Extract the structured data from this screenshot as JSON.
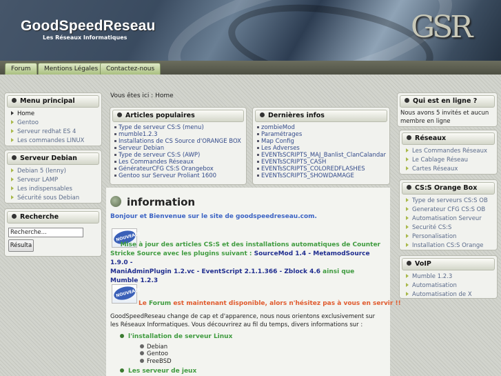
{
  "header": {
    "title": "GoodSpeedReseau",
    "tagline": "Les Réseaux Informatiques",
    "logo": "GSR"
  },
  "nav": {
    "tabs": [
      "Forum",
      "Mentions Légales",
      "Contactez-nous"
    ]
  },
  "breadcrumb": "Vous êtes ici : Home",
  "menu_principal": {
    "title": "Menu principal",
    "items": [
      "Home",
      "Gentoo",
      "Serveur redhat ES 4",
      "Les commandes LINUX"
    ]
  },
  "serveur_debian": {
    "title": "Serveur Debian",
    "items": [
      "Debian 5 (lenny)",
      "Serveur LAMP",
      "Les indispensables",
      "Sécurité sous Debian"
    ]
  },
  "recherche": {
    "title": "Recherche",
    "input_value": "Recherche...",
    "button": "Résulta"
  },
  "articles_populaires": {
    "title": "Articles populaires",
    "items": [
      "Type de serveur CS:S (menu)",
      "mumble1.2.3",
      "Installations de CS Source d'ORANGE BOX",
      "Serveur Debian",
      "Type de serveur CS:S (AWP)",
      "Les Commandes Réseaux",
      "GénérateurCFG CS:S Orangebox",
      "Gentoo sur Serveur Proliant 1600"
    ]
  },
  "dernieres_infos": {
    "title": "Dernières infos",
    "items": [
      "zombieMod",
      "Paramétrages",
      "Map Config",
      "Les Adverses",
      "EVENTsSCRIPTS_MAJ_Banlist_ClanCalandar",
      "EVENTsSCRIPTS_CASH",
      "EVENTsSCRIPTS_COLOREDFLASHES",
      "EVENTsSCRIPTS_SHOWDAMAGE"
    ]
  },
  "main": {
    "title": "information",
    "welcome": "Bonjour et Bienvenue sur le site de goodspeedreseau.com.",
    "badge_text": "NOUVEAU!",
    "update_green1": "Mise à jour des articles CS:S et des installations automatiques de Counter",
    "update_green2": "Stricke Source avec les plugins suivant : ",
    "update_blue1": "SourceMod 1.4 - MetamodSource 1.9.0 -",
    "update_blue2": "ManiAdminPlugin 1.2.vc - EventScript 2.1.1.366 - Zblock 4.6",
    "update_ainsi": " ainsi que ",
    "update_blue3": "Mumble 1.2.3",
    "forum_le": "Le ",
    "forum_link": "Forum",
    "forum_rest": " est maintenant disponible, alors n'hésitez pas à vous en servir !!",
    "paragraph": "GoodSpeedReseau change de cap et d'apparence, nous nous orientons exclusivement sur les Réseaux Informatiques. Vous découvrirez au fil du temps, divers informations sur :",
    "sub1": "l'installation de serveur Linux",
    "os": [
      "Debian",
      "Gentoo",
      "FreeBSD"
    ],
    "sub2": "Les serveur de jeux"
  },
  "qui_en_ligne": {
    "title": "Qui est en ligne ?",
    "text": "Nous avons 5 invités et aucun membre en ligne"
  },
  "reseaux": {
    "title": "Réseaux",
    "items": [
      "Les Commandes Réseaux",
      "Le Cablage Réseau",
      "Cartes Réseaux"
    ]
  },
  "css_orange_box": {
    "title": "CS:S Orange Box",
    "items": [
      "Type de serveurs CS:S OB",
      "Generateur CFG CS:S OB",
      "Automatisation Serveur",
      "Securité CS:S",
      "Personalisation",
      "Installation CS:S Orange"
    ]
  },
  "voip": {
    "title": "VoIP",
    "items": [
      "Mumble 1.2.3",
      "Automatisation",
      "Automatisation de X"
    ]
  }
}
